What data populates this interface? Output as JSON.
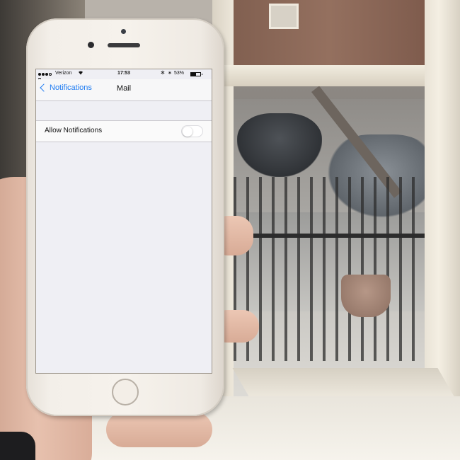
{
  "status_bar": {
    "carrier": "Verizon",
    "time": "17:53",
    "battery_percent": "53%",
    "battery_level": 0.53,
    "signal_bars_filled": 3,
    "signal_bars_total": 5,
    "icons": [
      "wifi-icon",
      "orientation-lock-icon",
      "bluetooth-icon",
      "battery-icon"
    ]
  },
  "nav_bar": {
    "back_label": "Notifications",
    "title": "Mail"
  },
  "settings": {
    "allow_notifications_label": "Allow Notifications",
    "allow_notifications_enabled": false
  },
  "colors": {
    "accent": "#1f7cf2",
    "background": "#efeff4",
    "cell": "#fafafa"
  }
}
